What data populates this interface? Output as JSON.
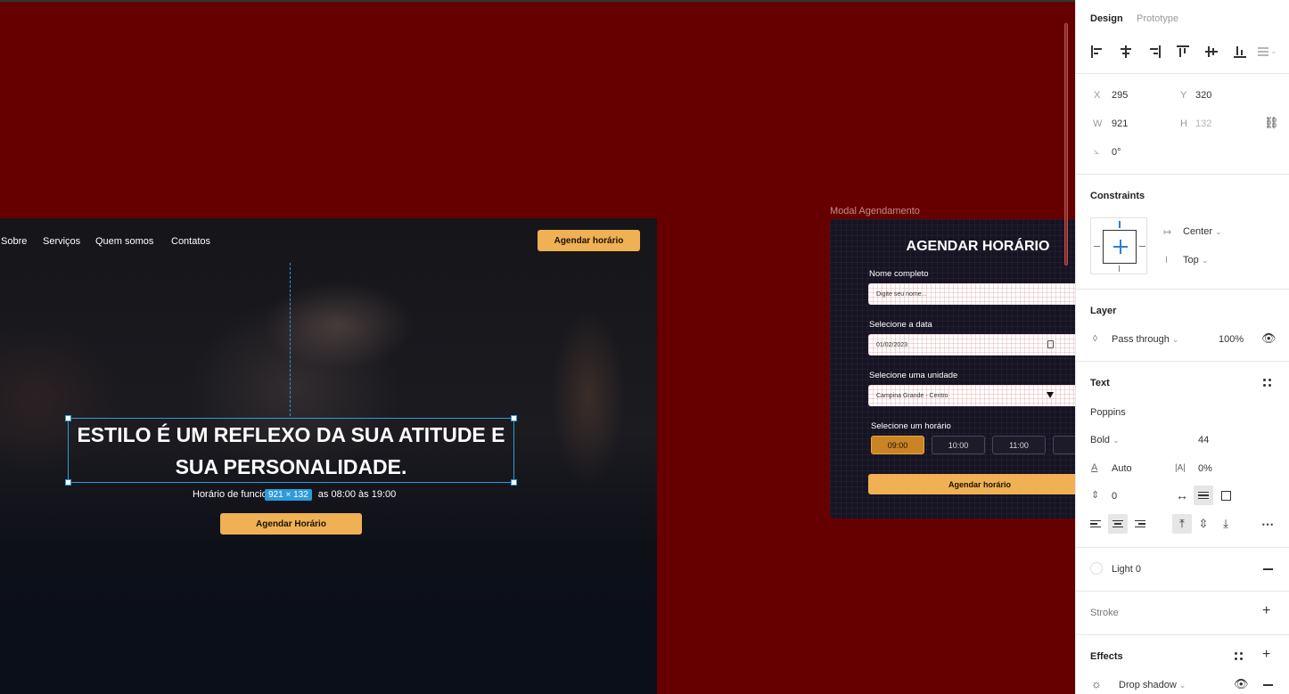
{
  "colors": {
    "canvas": "#660000",
    "accent_gold": "#f0b054",
    "selection_blue": "#2d9cdb",
    "panel_bg": "#ffffff"
  },
  "site": {
    "nav": [
      "Sobre",
      "Serviços",
      "Quem somos",
      "Contatos"
    ],
    "nav_cta": "Agendar horário",
    "hero_title_line1": "ESTILO É UM REFLEXO DA SUA ATITUDE E",
    "hero_title_line2": "SUA PERSONALIDADE.",
    "hours_prefix": "Horário de funcio",
    "hours_suffix": "as 08:00 às 19:00",
    "size_badge": "921 × 132",
    "hero_cta": "Agendar Horário"
  },
  "modal": {
    "frame_label": "Modal Agendamento",
    "title": "AGENDAR HORÁRIO",
    "name_label": "Nome completo",
    "name_placeholder": "Digite seu nome...",
    "date_label": "Selecione a data",
    "date_value": "01/02/2023",
    "unit_label": "Selecione uma unidade",
    "unit_value": "Campina Grande - Centro",
    "time_label": "Selecione um horário",
    "slots": [
      "09:00",
      "10:00",
      "11:00",
      "1"
    ],
    "submit": "Agendar horário"
  },
  "panel": {
    "tabs": {
      "design": "Design",
      "prototype": "Prototype"
    },
    "position": {
      "x_label": "X",
      "x": "295",
      "y_label": "Y",
      "y": "320"
    },
    "size": {
      "w_label": "W",
      "w": "921",
      "h_label": "H",
      "h": "132"
    },
    "rotation": "0°",
    "constraints": {
      "title": "Constraints",
      "horizontal": "Center",
      "vertical": "Top"
    },
    "layer": {
      "title": "Layer",
      "blend": "Pass through",
      "opacity": "100%"
    },
    "text": {
      "title": "Text",
      "font_family": "Poppins",
      "font_weight": "Bold",
      "font_size": "44",
      "line_height": "Auto",
      "letter_spacing": "0%",
      "paragraph_spacing": "0"
    },
    "style": {
      "name": "Light 0"
    },
    "stroke": {
      "title": "Stroke"
    },
    "effects": {
      "title": "Effects",
      "item": "Drop shadow"
    }
  }
}
